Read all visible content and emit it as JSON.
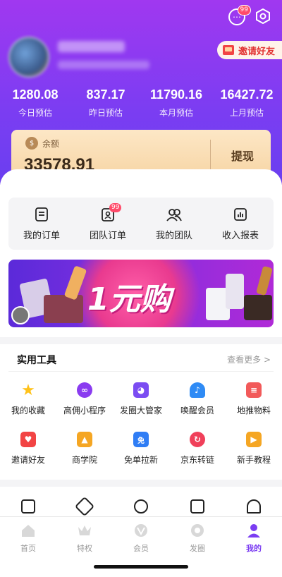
{
  "header": {
    "messages_badge": "99",
    "invite_label": "邀请好友"
  },
  "stats": [
    {
      "value": "1280.08",
      "label": "今日预估"
    },
    {
      "value": "837.17",
      "label": "昨日预估"
    },
    {
      "value": "11790.16",
      "label": "本月预估"
    },
    {
      "value": "16427.72",
      "label": "上月预估"
    }
  ],
  "balance": {
    "label": "余额",
    "value": "33578.91",
    "withdraw_label": "提现"
  },
  "orders": {
    "items": [
      {
        "label": "我的订单",
        "icon": "order-icon"
      },
      {
        "label": "团队订单",
        "icon": "team-order-icon",
        "badge": "99"
      },
      {
        "label": "我的团队",
        "icon": "team-icon"
      },
      {
        "label": "收入报表",
        "icon": "report-icon"
      }
    ]
  },
  "banner": {
    "text": "1元购"
  },
  "tools": {
    "title": "实用工具",
    "more": "查看更多 >",
    "items": [
      {
        "label": "我的收藏",
        "icon": "star-icon",
        "color": "#ffc21a"
      },
      {
        "label": "高佣小程序",
        "icon": "mini-program-icon",
        "color": "#8a3cf0"
      },
      {
        "label": "发圈大管家",
        "icon": "robot-icon",
        "color": "#7b4cf2"
      },
      {
        "label": "唤醒会员",
        "icon": "bell-icon",
        "color": "#2f8bf5"
      },
      {
        "label": "地推物料",
        "icon": "material-icon",
        "color": "#f25a5a"
      },
      {
        "label": "邀请好友",
        "icon": "envelope-icon",
        "color": "#f24444"
      },
      {
        "label": "商学院",
        "icon": "graduation-cap-icon",
        "color": "#f5a623"
      },
      {
        "label": "免单拉新",
        "icon": "free-ticket-icon",
        "color": "#2f7df5"
      },
      {
        "label": "京东转链",
        "icon": "link-icon",
        "color": "#f0405a"
      },
      {
        "label": "新手教程",
        "icon": "film-icon",
        "color": "#f5a623"
      }
    ]
  },
  "tabbar": {
    "items": [
      {
        "label": "首页",
        "icon": "home-icon"
      },
      {
        "label": "特权",
        "icon": "crown-icon"
      },
      {
        "label": "会员",
        "icon": "vip-icon"
      },
      {
        "label": "发圈",
        "icon": "circle-icon"
      },
      {
        "label": "我的",
        "icon": "profile-icon",
        "active": true
      }
    ]
  },
  "colors": {
    "accent": "#7b3df2",
    "header_gradient_top": "#a038f0",
    "badge": "#ff4b6a"
  }
}
